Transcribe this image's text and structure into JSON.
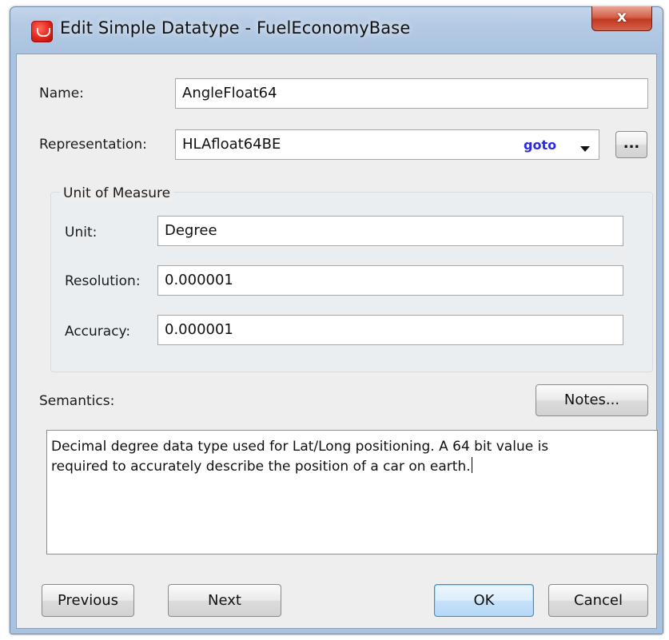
{
  "window": {
    "title": "Edit Simple Datatype - FuelEconomyBase",
    "close_label": "x"
  },
  "form": {
    "name": {
      "label": "Name:",
      "value": "AngleFloat64"
    },
    "representation": {
      "label": "Representation:",
      "value": "HLAfloat64BE",
      "goto_label": "goto",
      "browse_label": "..."
    },
    "unit_of_measure": {
      "title": "Unit of Measure",
      "unit": {
        "label": "Unit:",
        "value": "Degree"
      },
      "resolution": {
        "label": "Resolution:",
        "value": "0.000001"
      },
      "accuracy": {
        "label": "Accuracy:",
        "value": "0.000001"
      }
    },
    "semantics": {
      "label": "Semantics:",
      "notes_label": "Notes...",
      "value": "Decimal degree data type used for Lat/Long positioning. A 64 bit value is\nrequired to accurately describe the position of a car on earth."
    }
  },
  "buttons": {
    "previous": "Previous",
    "next": "Next",
    "ok": "OK",
    "cancel": "Cancel"
  },
  "colors": {
    "title_bar": "#b5cbe4",
    "close_button": "#c2381f",
    "link": "#2a2ae0",
    "client_background": "#eeeeee",
    "default_button_border": "#3c8bd6"
  },
  "icons": {
    "app": "app-logo-icon",
    "dropdown": "chevron-down-icon"
  }
}
